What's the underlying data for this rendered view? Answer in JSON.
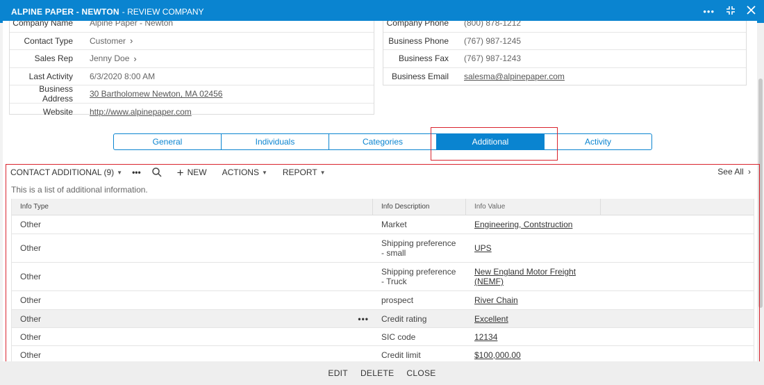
{
  "window": {
    "title_strong": "ALPINE PAPER - NEWTON",
    "title_light": "- REVIEW COMPANY",
    "icons": [
      "more-icon",
      "collapse-icon",
      "close-icon"
    ]
  },
  "left_fields": [
    {
      "label": "Company Name",
      "value": "Alpine Paper - Newton"
    },
    {
      "label": "Contact Type",
      "value": "Customer"
    },
    {
      "label": "Sales Rep",
      "value": "Jenny Doe"
    },
    {
      "label": "Last Activity",
      "value": "6/3/2020 8:00 AM"
    },
    {
      "label": "Business Address",
      "value": "30 Bartholomew Newton, MA 02456"
    },
    {
      "label": "Website",
      "value": "http://www.alpinepaper.com"
    }
  ],
  "right_fields": [
    {
      "label": "Company Phone",
      "value": "(800) 878-1212"
    },
    {
      "label": "Business Phone",
      "value": "(767) 987-1245"
    },
    {
      "label": "Business Fax",
      "value": "(767) 987-1243"
    },
    {
      "label": "Business Email",
      "value": "salesma@alpinepaper.com"
    }
  ],
  "tabs": [
    "General",
    "Individuals",
    "Categories",
    "Additional",
    "Activity"
  ],
  "active_tab": "Additional",
  "toolbar": {
    "list_title": "CONTACT ADDITIONAL (9)",
    "more": "•••",
    "new_label": "NEW",
    "actions_label": "ACTIONS",
    "report_label": "REPORT",
    "see_all": "See All"
  },
  "description": "This is a list of additional information.",
  "grid": {
    "headers": [
      "Info Type",
      "Info Description",
      "Info Value"
    ],
    "rows": [
      {
        "type": "Other",
        "description": "Market",
        "value": "Engineering, Contstruction"
      },
      {
        "type": "Other",
        "description": "Shipping preference - small",
        "value": "UPS"
      },
      {
        "type": "Other",
        "description": "Shipping preference - Truck",
        "value": "New England Motor Freight (NEMF)"
      },
      {
        "type": "Other",
        "description": "prospect",
        "value": "River Chain"
      },
      {
        "type": "Other",
        "description": "Credit rating",
        "value": "Excellent"
      },
      {
        "type": "Other",
        "description": "SIC code",
        "value": "12134"
      },
      {
        "type": "Other",
        "description": "Credit limit",
        "value": "$100,000.00"
      }
    ],
    "row_menu": "•••"
  },
  "footer": {
    "edit": "EDIT",
    "delete": "DELETE",
    "close": "CLOSE"
  },
  "colors": {
    "accent": "#0a84d0",
    "highlight_border": "#d9232d"
  }
}
